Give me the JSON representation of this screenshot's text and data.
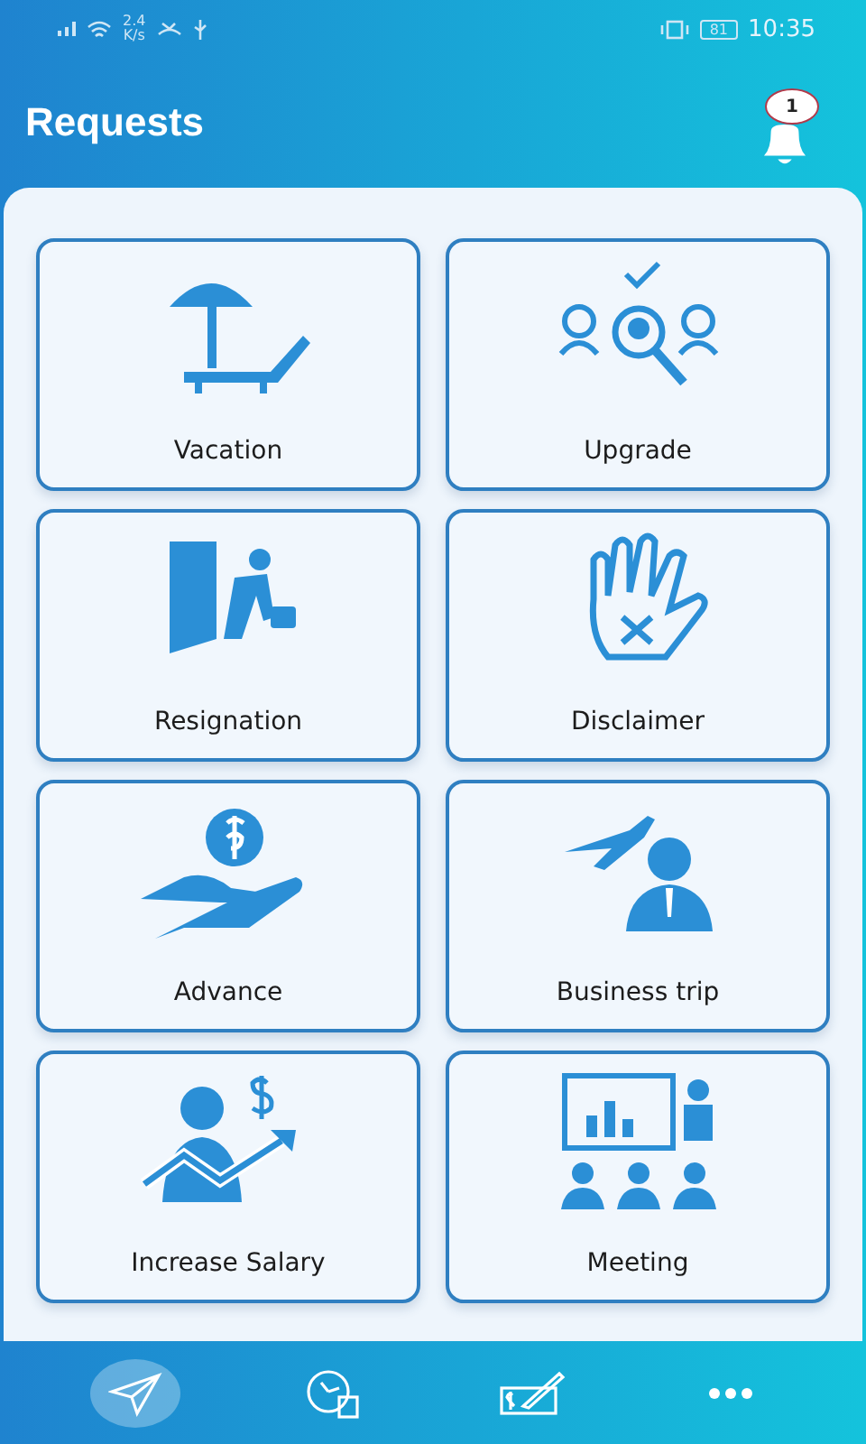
{
  "status_bar": {
    "speed": "2.4",
    "speed_unit": "K/s",
    "battery": "81",
    "time": "10:35"
  },
  "header": {
    "title": "Requests",
    "notification_count": "1"
  },
  "requests": [
    {
      "kind": "vacation",
      "label": "Vacation"
    },
    {
      "kind": "upgrade",
      "label": "Upgrade"
    },
    {
      "kind": "resignation",
      "label": "Resignation"
    },
    {
      "kind": "disclaimer",
      "label": "Disclaimer"
    },
    {
      "kind": "advance",
      "label": "Advance"
    },
    {
      "kind": "trip",
      "label": "Business trip"
    },
    {
      "kind": "salary",
      "label": "Increase Salary"
    },
    {
      "kind": "meeting",
      "label": "Meeting"
    }
  ],
  "bottom_nav": [
    {
      "kind": "send",
      "selected": true
    },
    {
      "kind": "clock",
      "selected": false
    },
    {
      "kind": "cheque",
      "selected": false
    },
    {
      "kind": "more",
      "selected": false
    }
  ]
}
